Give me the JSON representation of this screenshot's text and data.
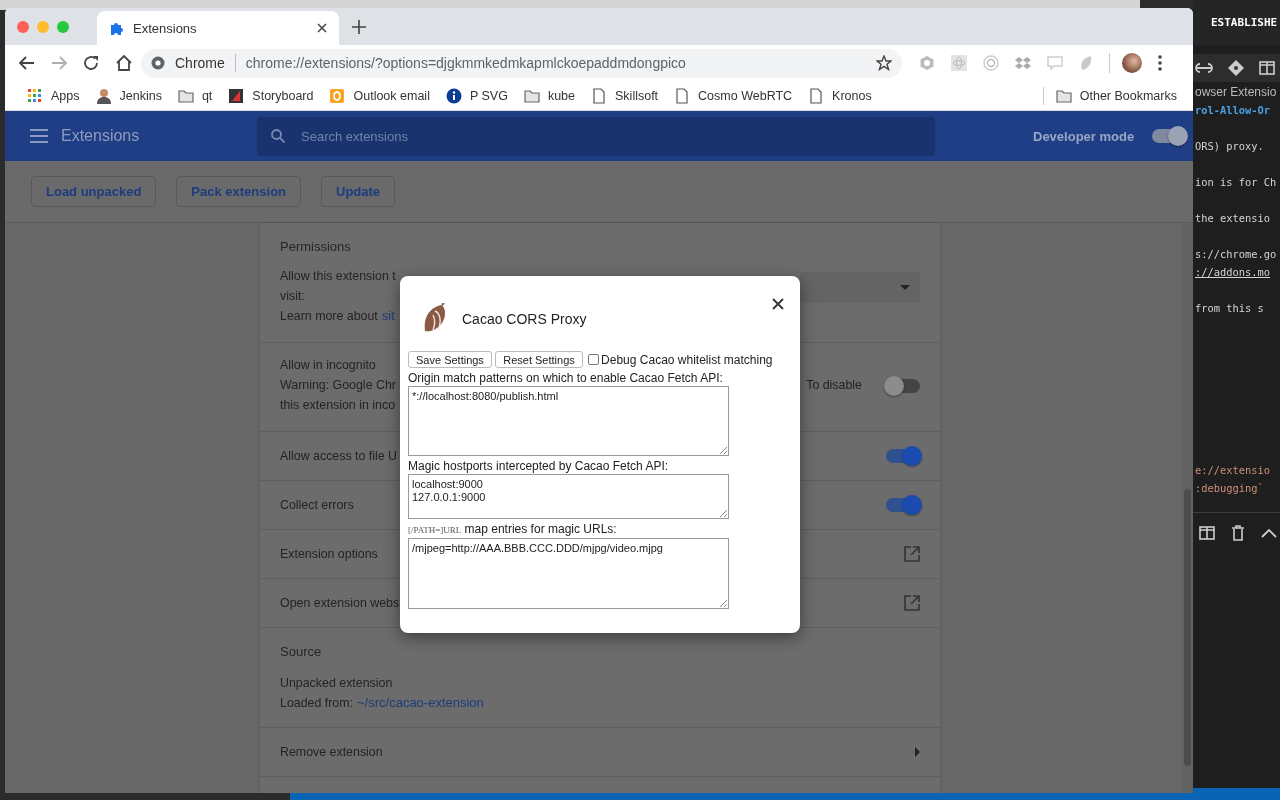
{
  "browser": {
    "tab": {
      "title": "Extensions",
      "selected": true
    },
    "forward_button": {
      "disabled": true
    },
    "omnibox": {
      "site_label": "Chrome",
      "url": "chrome://extensions/?options=djgkmmkedmkapmlckoepaddmdongpico"
    },
    "bookmarks": [
      {
        "label": "Apps",
        "kind": "apps"
      },
      {
        "label": "Jenkins",
        "kind": "person"
      },
      {
        "label": "qt",
        "kind": "folder"
      },
      {
        "label": "Storyboard",
        "kind": "storyboard"
      },
      {
        "label": "Outlook email",
        "kind": "outlook"
      },
      {
        "label": "P SVG",
        "kind": "info"
      },
      {
        "label": "kube",
        "kind": "folder"
      },
      {
        "label": "Skillsoft",
        "kind": "page"
      },
      {
        "label": "Cosmo WebRTC",
        "kind": "page"
      },
      {
        "label": "Kronos",
        "kind": "page"
      }
    ],
    "other_bookmarks": "Other Bookmarks"
  },
  "extensions_page": {
    "title": "Extensions",
    "search": {
      "placeholder": "Search extensions"
    },
    "developer_mode": {
      "label": "Developer mode",
      "on": true
    },
    "toolbar_buttons": [
      "Load unpacked",
      "Pack extension",
      "Update"
    ],
    "permissions": {
      "title": "Permissions",
      "line_1": "Allow this extension t",
      "line_2": "visit:",
      "learn_more": "Learn more about",
      "learn_more_link": "sit"
    },
    "incognito": {
      "label": "Allow in incognito",
      "warning_1": "Warning: Google Chr",
      "warning_2": "this extension in inco",
      "warning_right": "To disable",
      "on": false
    },
    "rows": [
      {
        "kind": "toggle",
        "label": "Allow access to file U",
        "on": true
      },
      {
        "kind": "toggle",
        "label": "Collect errors",
        "on": true
      },
      {
        "kind": "link",
        "label": "Extension options"
      },
      {
        "kind": "link",
        "label": "Open extension webs"
      }
    ],
    "source": {
      "title": "Source",
      "type": "Unpacked extension",
      "loaded_from": "Loaded from:",
      "path": "~/src/cacao-extension"
    },
    "remove": {
      "label": "Remove extension"
    }
  },
  "dialog": {
    "title": "Cacao CORS Proxy",
    "buttons": [
      "Save Settings",
      "Reset Settings"
    ],
    "debug_checkbox": {
      "label": "Debug Cacao whitelist matching",
      "checked": false
    },
    "fields": [
      {
        "label": "Origin match patterns on which to enable Cacao Fetch API:",
        "value": "*://localhost:8080/publish.html"
      },
      {
        "label": "Magic hostports intercepted by Cacao Fetch API:",
        "value": "localhost:9000\n127.0.0.1:9000"
      },
      {
        "label_code": "[/PATH=]URL",
        "label": "map entries for magic URLs:",
        "value": "/mjpeg=http://AAA.BBB.CCC.DDD/mjpg/video.mjpg"
      }
    ]
  },
  "editor": {
    "title": "ESTABLISHE",
    "lines": [
      {
        "text": "owser Extensio",
        "kind": "heading"
      },
      {
        "text": "rol-Allow-Or",
        "kind": "code"
      },
      {
        "text": "ORS) proxy.",
        "kind": "text"
      },
      {
        "text": "ion is for Ch",
        "kind": "text"
      },
      {
        "text": "the extensio",
        "kind": "text"
      },
      {
        "text": "s://chrome.go",
        "kind": "text"
      },
      {
        "text": "://addons.mo",
        "kind": "link"
      },
      {
        "text": "from this s",
        "kind": "text"
      },
      {
        "text": "e://extensio",
        "kind": "string"
      },
      {
        "text": ":debugging`",
        "kind": "string"
      }
    ]
  }
}
